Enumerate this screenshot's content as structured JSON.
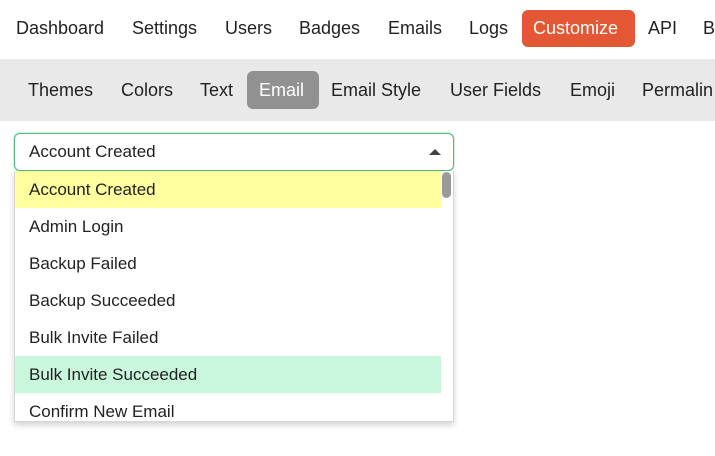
{
  "topnav": {
    "items": [
      {
        "label": "Dashboard"
      },
      {
        "label": "Settings"
      },
      {
        "label": "Users"
      },
      {
        "label": "Badges"
      },
      {
        "label": "Emails"
      },
      {
        "label": "Logs"
      },
      {
        "label": "Customize",
        "active": true
      },
      {
        "label": "API"
      },
      {
        "label": "B"
      }
    ],
    "active_color": "#e45735"
  },
  "subnav": {
    "items": [
      {
        "label": "Themes"
      },
      {
        "label": "Colors"
      },
      {
        "label": "Text"
      },
      {
        "label": "Email",
        "active": true
      },
      {
        "label": "Email Style"
      },
      {
        "label": "User Fields"
      },
      {
        "label": "Emoji"
      },
      {
        "label": "Permalin"
      }
    ],
    "active_color": "#919191"
  },
  "template_select": {
    "selected_value": "Account Created",
    "caret_icon": "caret-up-icon",
    "options": [
      {
        "label": "Account Created",
        "state": "selected"
      },
      {
        "label": "Admin Login"
      },
      {
        "label": "Backup Failed"
      },
      {
        "label": "Backup Succeeded"
      },
      {
        "label": "Bulk Invite Failed"
      },
      {
        "label": "Bulk Invite Succeeded",
        "state": "hover"
      },
      {
        "label": "Confirm New Email"
      }
    ],
    "selected_color": "#ffff9f",
    "hover_color": "#c8f7dc"
  }
}
